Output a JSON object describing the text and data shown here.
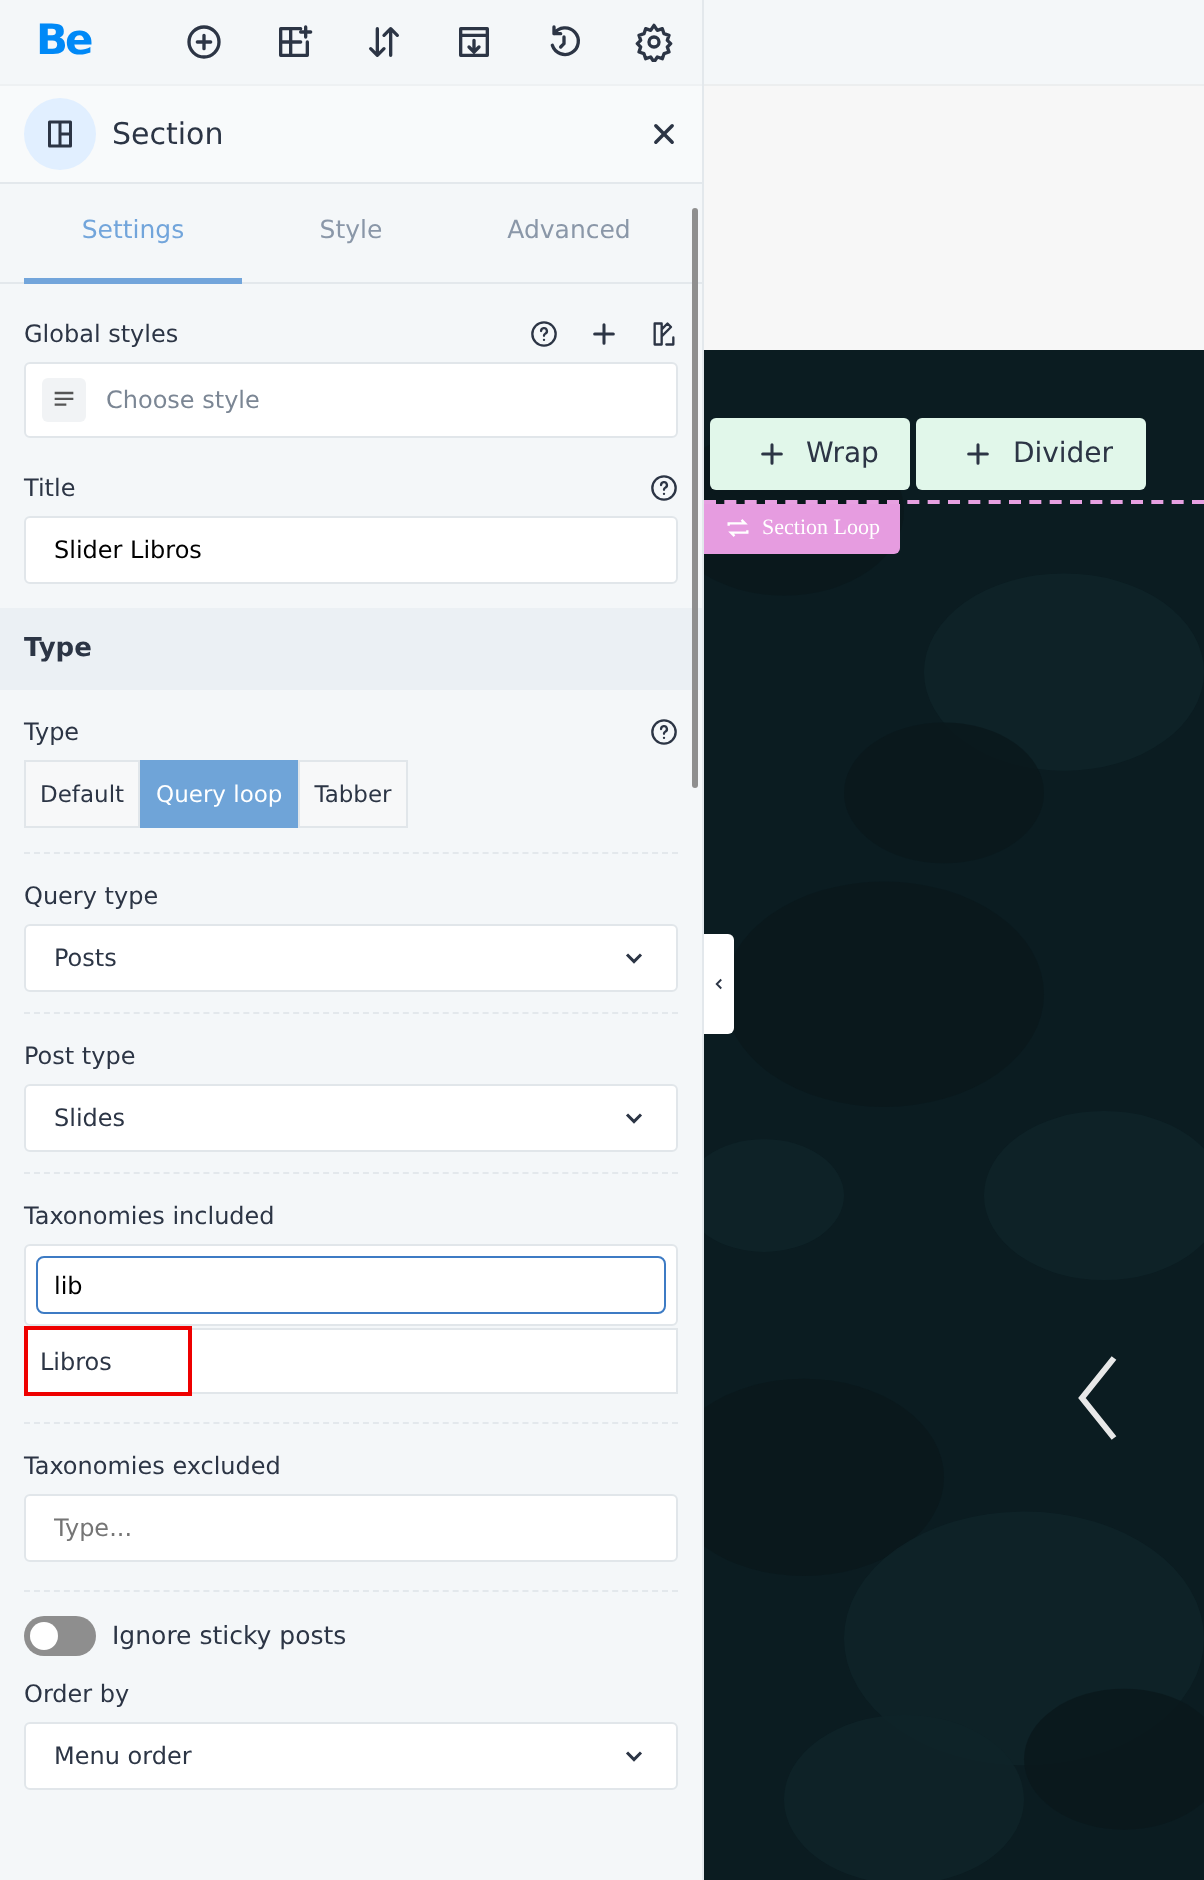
{
  "toolbar": {
    "logo": "Be"
  },
  "panel": {
    "title": "Section",
    "tabs": [
      {
        "label": "Settings",
        "selected": true
      },
      {
        "label": "Style",
        "selected": false
      },
      {
        "label": "Advanced",
        "selected": false
      }
    ],
    "fields": [
      {
        "kind": "styles",
        "label": "Global styles",
        "help": true,
        "placeholder": "Choose style"
      },
      {
        "kind": "text",
        "label": "Title",
        "help": true,
        "value": "Slider Libros"
      },
      {
        "kind": "heading",
        "label": "Type"
      },
      {
        "kind": "segmented",
        "label": "Type",
        "help": true,
        "options": [
          {
            "label": "Default",
            "selected": false
          },
          {
            "label": "Query loop",
            "selected": true
          },
          {
            "label": "Tabber",
            "selected": false
          }
        ]
      },
      {
        "kind": "select",
        "label": "Query type",
        "help": false,
        "value": "Posts"
      },
      {
        "kind": "select",
        "label": "Post type",
        "help": false,
        "value": "Slides"
      },
      {
        "kind": "search",
        "label": "Taxonomies included",
        "help": false,
        "value": "lib",
        "suggestion": "Libros"
      },
      {
        "kind": "text",
        "label": "Taxonomies excluded",
        "help": false,
        "placeholder": "Type..."
      },
      {
        "kind": "toggle",
        "label": "Ignore sticky posts",
        "on": false
      },
      {
        "kind": "select",
        "label": "Order by",
        "help": false,
        "value": "Menu order"
      }
    ]
  },
  "canvas": {
    "buttons": [
      "Wrap",
      "Divider"
    ],
    "loop_label": "Section Loop"
  }
}
